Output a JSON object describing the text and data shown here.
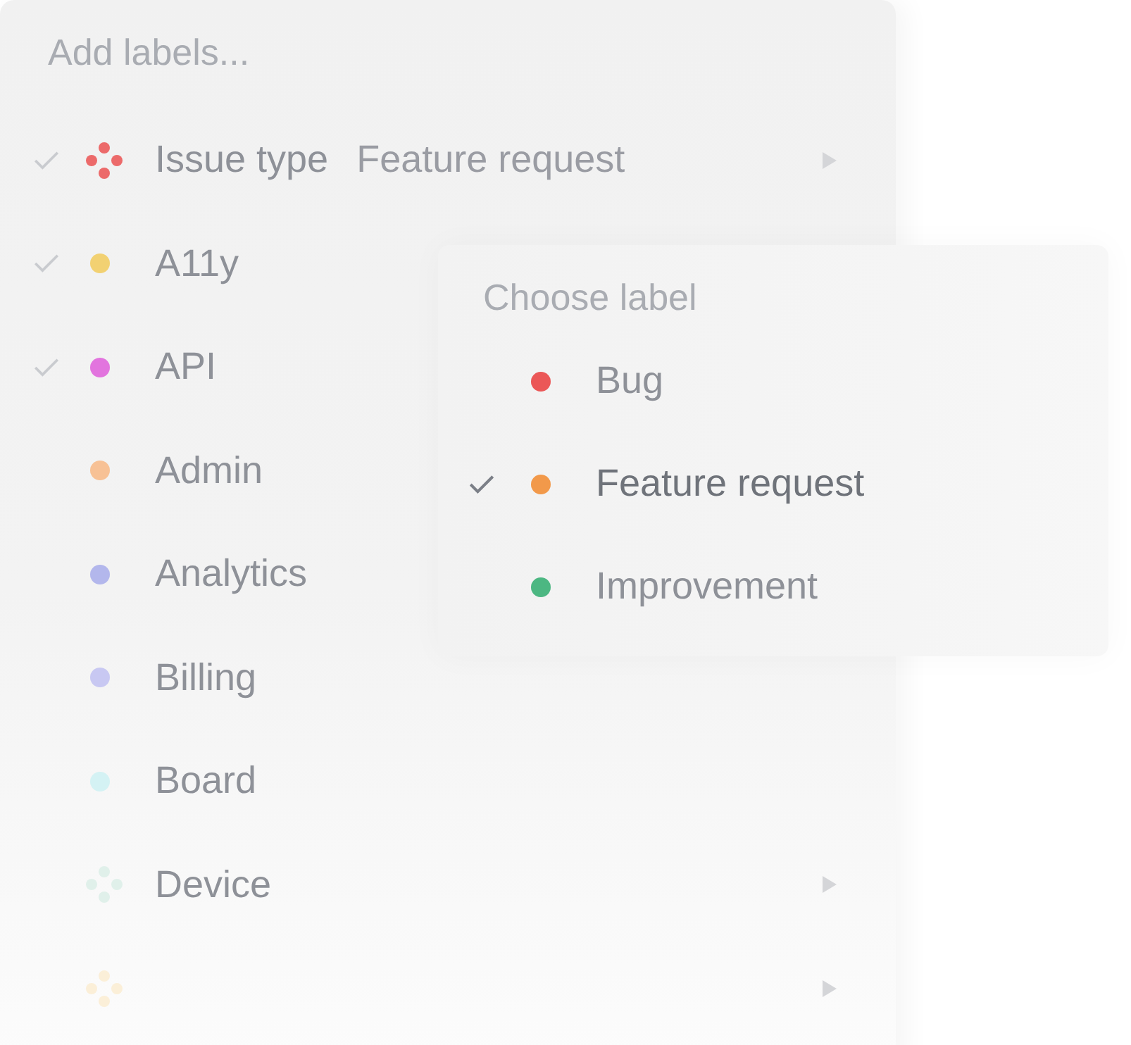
{
  "search": {
    "placeholder": "Add labels..."
  },
  "labels": [
    {
      "kind": "group",
      "name": "Issue type",
      "value": "Feature request",
      "checked": true,
      "color": "#ec6a6a"
    },
    {
      "kind": "label",
      "name": "A11y",
      "checked": true,
      "color": "#f2d172"
    },
    {
      "kind": "label",
      "name": "API",
      "checked": true,
      "color": "#e274de"
    },
    {
      "kind": "label",
      "name": "Admin",
      "checked": false,
      "color": "#f7c195"
    },
    {
      "kind": "label",
      "name": "Analytics",
      "checked": false,
      "color": "#b3b7ec"
    },
    {
      "kind": "label",
      "name": "Billing",
      "checked": false,
      "color": "#c8c8f2"
    },
    {
      "kind": "label",
      "name": "Board",
      "checked": false,
      "color": "#d4f2f4"
    },
    {
      "kind": "group",
      "name": "Device",
      "checked": false,
      "color": "#e0f0ea"
    },
    {
      "kind": "group",
      "checked": false,
      "color": "#fbefd8"
    }
  ],
  "submenu": {
    "placeholder": "Choose label",
    "options": [
      {
        "name": "Bug",
        "selected": false,
        "color": "#eb5757"
      },
      {
        "name": "Feature request",
        "selected": true,
        "color": "#f2994a"
      },
      {
        "name": "Improvement",
        "selected": false,
        "color": "#4cb782"
      }
    ]
  }
}
